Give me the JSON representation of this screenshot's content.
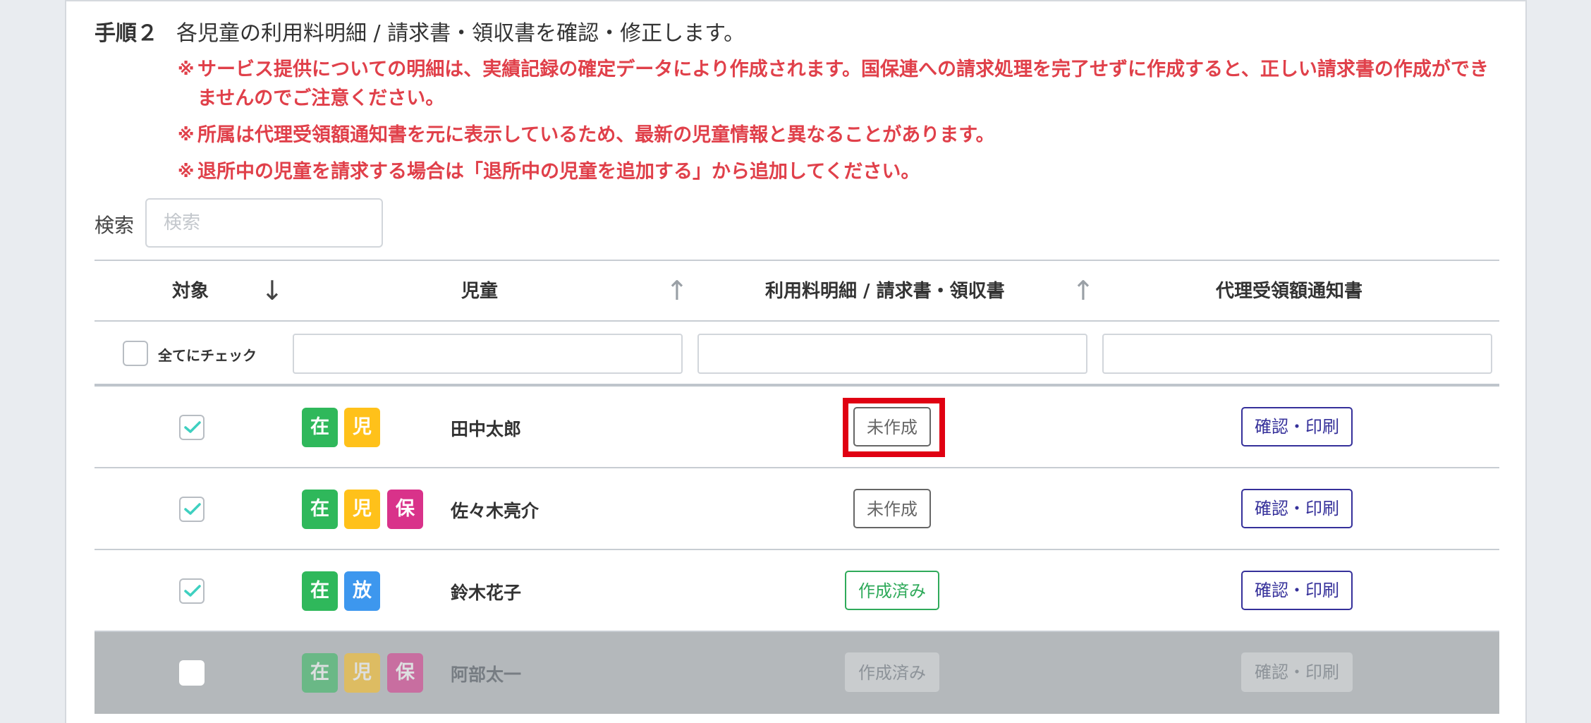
{
  "step": {
    "number": "手順２",
    "description": "各児童の利用料明細 / 請求書・領収書を確認・修正します。"
  },
  "notes": [
    {
      "mark": "※",
      "text": "サービス提供についての明細は、実績記録の確定データにより作成されます。国保連への請求処理を完了せずに作成すると、正しい請求書の作成ができませんのでご注意ください。"
    },
    {
      "mark": "※",
      "text": "所属は代理受領額通知書を元に表示しているため、最新の児童情報と異なることがあります。"
    },
    {
      "mark": "※",
      "text": "退所中の児童を請求する場合は「退所中の児童を追加する」から追加してください。"
    }
  ],
  "search": {
    "label": "検索",
    "placeholder": "検索",
    "value": ""
  },
  "table": {
    "headers": {
      "target": "対象",
      "child": "児童",
      "statement": "利用料明細 / 請求書・領収書",
      "notice": "代理受領額通知書"
    },
    "sort_arrows": {
      "target": "↓",
      "child": "↑",
      "statement": "↑"
    },
    "check_all_label": "全てにチェック",
    "rows": [
      {
        "checked": true,
        "badges": [
          "在",
          "児"
        ],
        "name": "田中太郎",
        "status": "未作成",
        "action": "確認・印刷",
        "disabled": false
      },
      {
        "checked": true,
        "badges": [
          "在",
          "児",
          "保"
        ],
        "name": "佐々木亮介",
        "status": "未作成",
        "action": "確認・印刷",
        "disabled": false
      },
      {
        "checked": true,
        "badges": [
          "在",
          "放"
        ],
        "name": "鈴木花子",
        "status": "作成済み",
        "action": "確認・印刷",
        "disabled": false
      },
      {
        "checked": false,
        "badges": [
          "在",
          "児",
          "保"
        ],
        "name": "阿部太一",
        "status": "作成済み",
        "action": "確認・印刷",
        "disabled": true
      }
    ]
  },
  "colors": {
    "note_red": "#e0404a",
    "badge_green": "#2fb85b",
    "badge_yellow": "#ffc11a",
    "badge_pink": "#d9328a",
    "badge_blue": "#3d97ee",
    "done_green": "#2faa5a",
    "action_navy": "#35309a",
    "highlight_red": "#e00012",
    "checkmark_teal": "#3ed0c0"
  }
}
